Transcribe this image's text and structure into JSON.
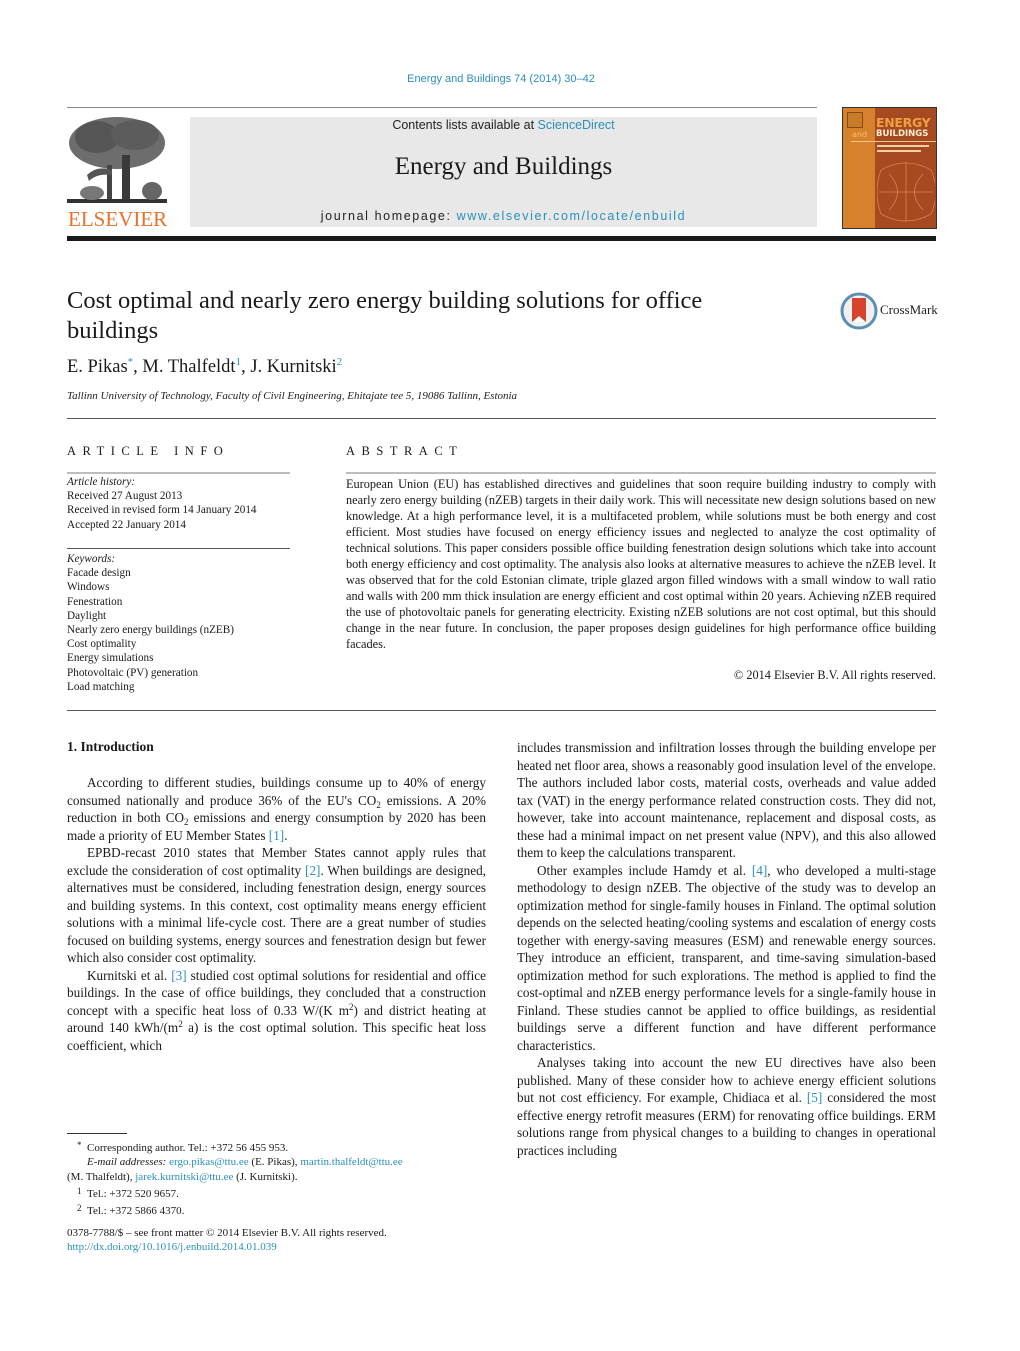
{
  "header": {
    "journal_reference": "Energy and Buildings 74 (2014) 30–42",
    "contents_prefix": "Contents lists available at ",
    "contents_link": "ScienceDirect",
    "journal_name": "Energy and Buildings",
    "homepage_prefix": "journal homepage: ",
    "homepage_link": "www.elsevier.com/locate/enbuild",
    "publisher_logo_text": "ELSEVIER",
    "cover": {
      "title_line1": "ENERGY",
      "title_and": "and",
      "title_line2": "BUILDINGS"
    },
    "colors": {
      "link": "#2a8fbd",
      "elsevier_orange": "#e8722c",
      "cover_orange": "#d7812d",
      "cover_rust": "#a64a22"
    }
  },
  "article": {
    "title": "Cost optimal and nearly zero energy building solutions for office buildings",
    "crossmark_label": "CrossMark",
    "authors": [
      {
        "name": "E. Pikas",
        "mark": "*"
      },
      {
        "name": "M. Thalfeldt",
        "mark": "1"
      },
      {
        "name": "J. Kurnitski",
        "mark": "2"
      }
    ],
    "affiliation": "Tallinn University of Technology, Faculty of Civil Engineering, Ehitajate tee 5, 19086 Tallinn, Estonia"
  },
  "article_info": {
    "heading": "ARTICLE INFO",
    "history_label": "Article history:",
    "history": [
      "Received 27 August 2013",
      "Received in revised form 14 January 2014",
      "Accepted 22 January 2014"
    ],
    "keywords_label": "Keywords:",
    "keywords": [
      "Facade design",
      "Windows",
      "Fenestration",
      "Daylight",
      "Nearly zero energy buildings (nZEB)",
      "Cost optimality",
      "Energy simulations",
      "Photovoltaic (PV) generation",
      "Load matching"
    ]
  },
  "abstract": {
    "heading": "ABSTRACT",
    "text": "European Union (EU) has established directives and guidelines that soon require building industry to comply with nearly zero energy building (nZEB) targets in their daily work. This will necessitate new design solutions based on new knowledge. At a high performance level, it is a multifaceted problem, while solutions must be both energy and cost efficient. Most studies have focused on energy efficiency issues and neglected to analyze the cost optimality of technical solutions. This paper considers possible office building fenestration design solutions which take into account both energy efficiency and cost optimality. The analysis also looks at alternative measures to achieve the nZEB level. It was observed that for the cold Estonian climate, triple glazed argon filled windows with a small window to wall ratio and walls with 200 mm thick insulation are energy efficient and cost optimal within 20 years. Achieving nZEB required the use of photovoltaic panels for generating electricity. Existing nZEB solutions are not cost optimal, but this should change in the near future. In conclusion, the paper proposes design guidelines for high performance office building facades.",
    "copyright": "© 2014 Elsevier B.V. All rights reserved."
  },
  "body": {
    "section_heading": "1.  Introduction",
    "left": {
      "p1_a": "According to different studies, buildings consume up to 40% of energy consumed nationally and produce 36% of the EU's CO",
      "p1_b": " emissions. A 20% reduction in both CO",
      "p1_c": " emissions and energy consumption by 2020 has been made a priority of EU Member States ",
      "p1_ref": "[1]",
      "p1_end": ".",
      "p2_a": "EPBD-recast 2010 states that Member States cannot apply rules that exclude the consideration of cost optimality ",
      "p2_ref": "[2]",
      "p2_b": ". When buildings are designed, alternatives must be considered, including fenestration design, energy sources and building systems. In this context, cost optimality means energy efficient solutions with a minimal life-cycle cost. There are a great number of studies focused on building systems, energy sources and fenestration design but fewer which also consider cost optimality.",
      "p3_a": "Kurnitski et al. ",
      "p3_ref": "[3]",
      "p3_b": " studied cost optimal solutions for residential and office buildings. In the case of office buildings, they concluded that a construction concept with a specific heat loss of 0.33 W/(K m",
      "p3_c": ") and district heating at around 140 kWh/(m",
      "p3_d": " a) is the cost optimal solution. This specific heat loss coefficient, which",
      "subscript_2": "2",
      "superscript_2": "2"
    },
    "right": {
      "p1": "includes transmission and infiltration losses through the building envelope per heated net floor area, shows a reasonably good insulation level of the envelope. The authors included labor costs, material costs, overheads and value added tax (VAT) in the energy performance related construction costs. They did not, however, take into account maintenance, replacement and disposal costs, as these had a minimal impact on net present value (NPV), and this also allowed them to keep the calculations transparent.",
      "p2_a": "Other examples include Hamdy et al. ",
      "p2_ref": "[4]",
      "p2_b": ", who developed a multi-stage methodology to design nZEB. The objective of the study was to develop an optimization method for single-family houses in Finland. The optimal solution depends on the selected heating/cooling systems and escalation of energy costs together with energy-saving measures (ESM) and renewable energy sources. They introduce an efficient, transparent, and time-saving simulation-based optimization method for such explorations. The method is applied to find the cost-optimal and nZEB energy performance levels for a single-family house in Finland. These studies cannot be applied to office buildings, as residential buildings serve a different function and have different performance characteristics.",
      "p3_a": "Analyses taking into account the new EU directives have also been published. Many of these consider how to achieve energy efficient solutions but not cost efficiency. For example, Chidiaca et al. ",
      "p3_ref": "[5]",
      "p3_b": " considered the most effective energy retrofit measures (ERM) for renovating office buildings. ERM solutions range from physical changes to a building to changes in operational practices including"
    }
  },
  "footnotes": {
    "corresponding_mark": "*",
    "corresponding": "Corresponding author. Tel.: +372 56 455 953.",
    "email_label": "E-mail addresses:",
    "emails": [
      {
        "address": "ergo.pikas@ttu.ee",
        "name": "(E. Pikas),"
      },
      {
        "address": "martin.thalfeldt@ttu.ee",
        "name": "(M. Thalfeldt),"
      },
      {
        "address": "jarek.kurnitski@ttu.ee",
        "name": "(J. Kurnitski)."
      }
    ],
    "fn1_mark": "1",
    "fn1": "Tel.: +372 520 9657.",
    "fn2_mark": "2",
    "fn2": "Tel.: +372 5866 4370.",
    "issn": "0378-7788/$ – see front matter © 2014 Elsevier B.V. All rights reserved.",
    "doi": "http://dx.doi.org/10.1016/j.enbuild.2014.01.039"
  }
}
